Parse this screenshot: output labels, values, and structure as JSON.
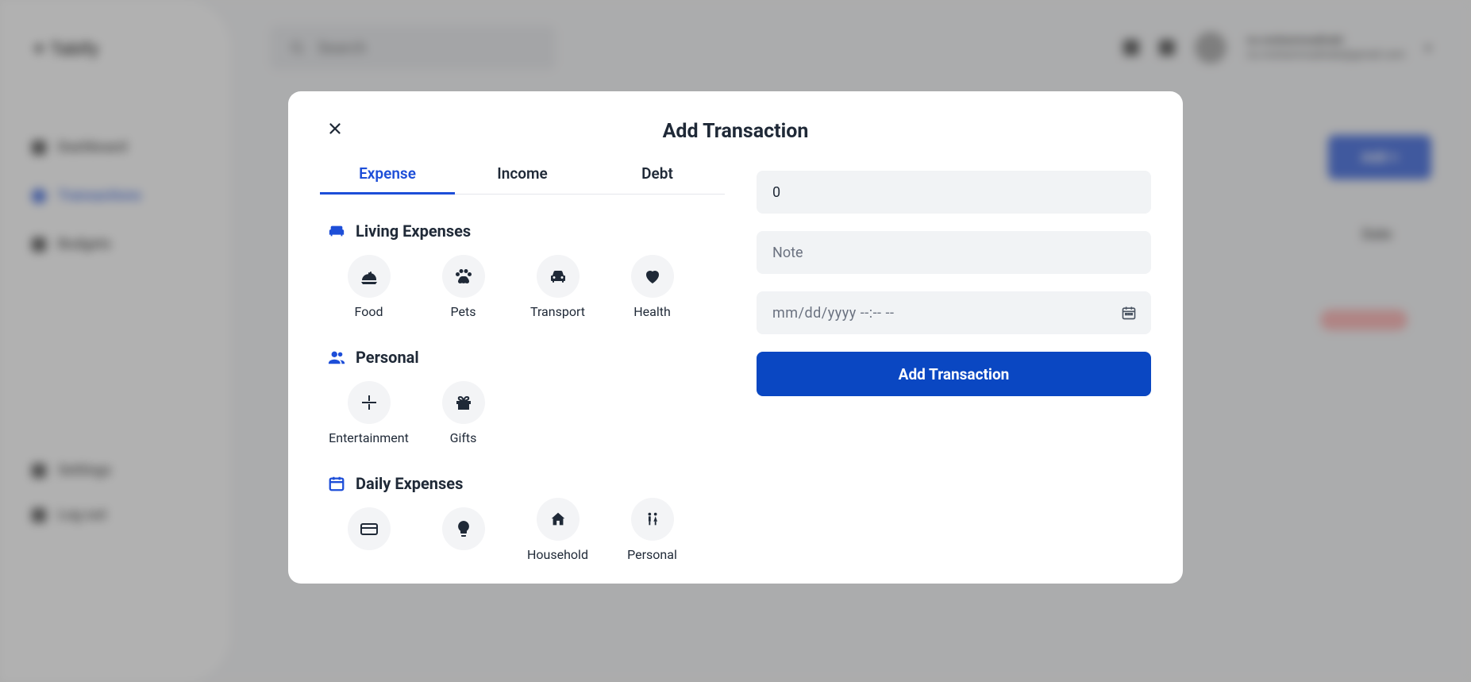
{
  "bg": {
    "logo": "✦ Tabify",
    "search_placeholder": "Search",
    "nav": {
      "dashboard": "Dashboard",
      "transactions": "Transactions",
      "budgets": "Budgets",
      "settings": "Settings",
      "logout": "Log out"
    },
    "user_name": "ns.mohammadirabi",
    "user_email": "ns.mohammadirabi@gmail.com",
    "add_btn": "Add  +",
    "col_date": "Date"
  },
  "modal": {
    "title": "Add Transaction",
    "tabs": {
      "expense": "Expense",
      "income": "Income",
      "debt": "Debt"
    },
    "groups": {
      "living": {
        "title": "Living Expenses",
        "items": {
          "food": "Food",
          "pets": "Pets",
          "transport": "Transport",
          "health": "Health"
        }
      },
      "personal": {
        "title": "Personal",
        "items": {
          "entertainment": "Entertainment",
          "gifts": "Gifts"
        }
      },
      "daily": {
        "title": "Daily Expenses",
        "items": {
          "card": "",
          "bulb": "",
          "household": "Household",
          "personal": "Personal"
        }
      }
    },
    "amount_value": "0",
    "note_placeholder": "Note",
    "date_placeholder": "mm/dd/yyyy --:-- --",
    "submit": "Add Transaction"
  }
}
